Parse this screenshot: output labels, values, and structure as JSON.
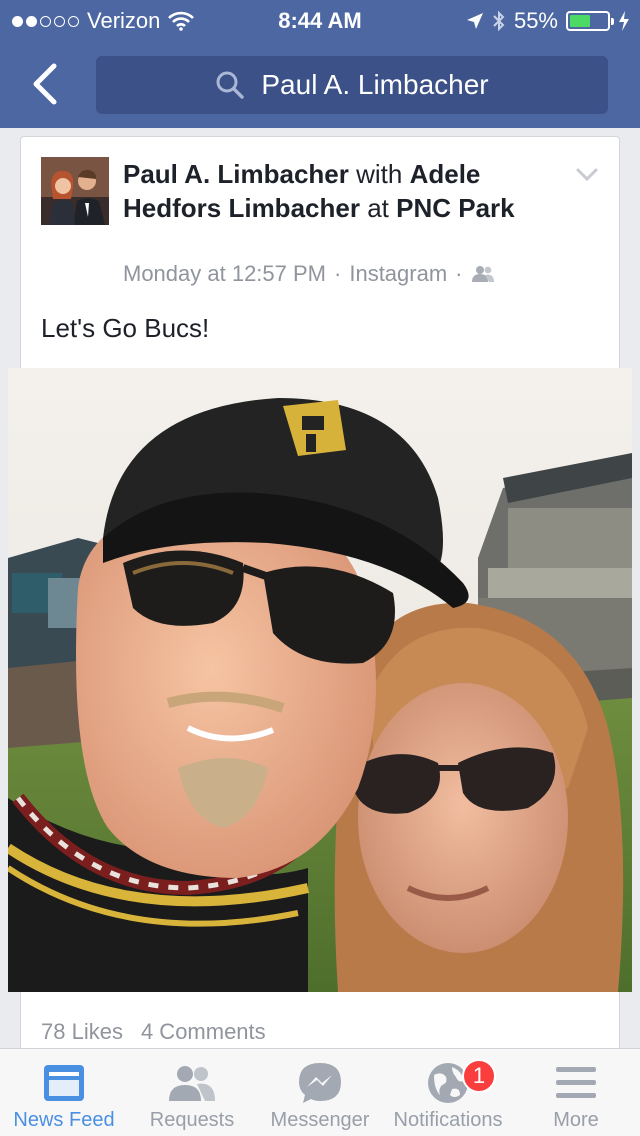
{
  "status_bar": {
    "carrier": "Verizon",
    "time": "8:44 AM",
    "battery_percent": "55%",
    "battery_level": 0.55,
    "signal_bars": 2
  },
  "nav": {
    "back_icon": "chevron-left-icon",
    "search_value": "Paul A. Limbacher"
  },
  "post": {
    "author": "Paul A. Limbacher",
    "with_word": "with",
    "tagged": "Adele Hedfors Limbacher",
    "at_word": "at",
    "place": "PNC Park",
    "time": "Monday at 12:57 PM",
    "separator": "·",
    "source": "Instagram",
    "audience_icon": "friends-icon",
    "text": "Let's Go Bucs!",
    "likes": "78 Likes",
    "comments": "4 Comments"
  },
  "tabbar": {
    "tabs": [
      {
        "label": "News Feed",
        "icon": "news-feed-icon"
      },
      {
        "label": "Requests",
        "icon": "requests-icon"
      },
      {
        "label": "Messenger",
        "icon": "messenger-icon"
      },
      {
        "label": "Notifications",
        "icon": "notifications-globe-icon"
      },
      {
        "label": "More",
        "icon": "menu-icon"
      }
    ],
    "notifications_badge": "1"
  },
  "colors": {
    "header": "#4c67a1",
    "search_bg": "#3b5187",
    "active_tab": "#4a90e2",
    "badge": "#fa3e3e"
  }
}
